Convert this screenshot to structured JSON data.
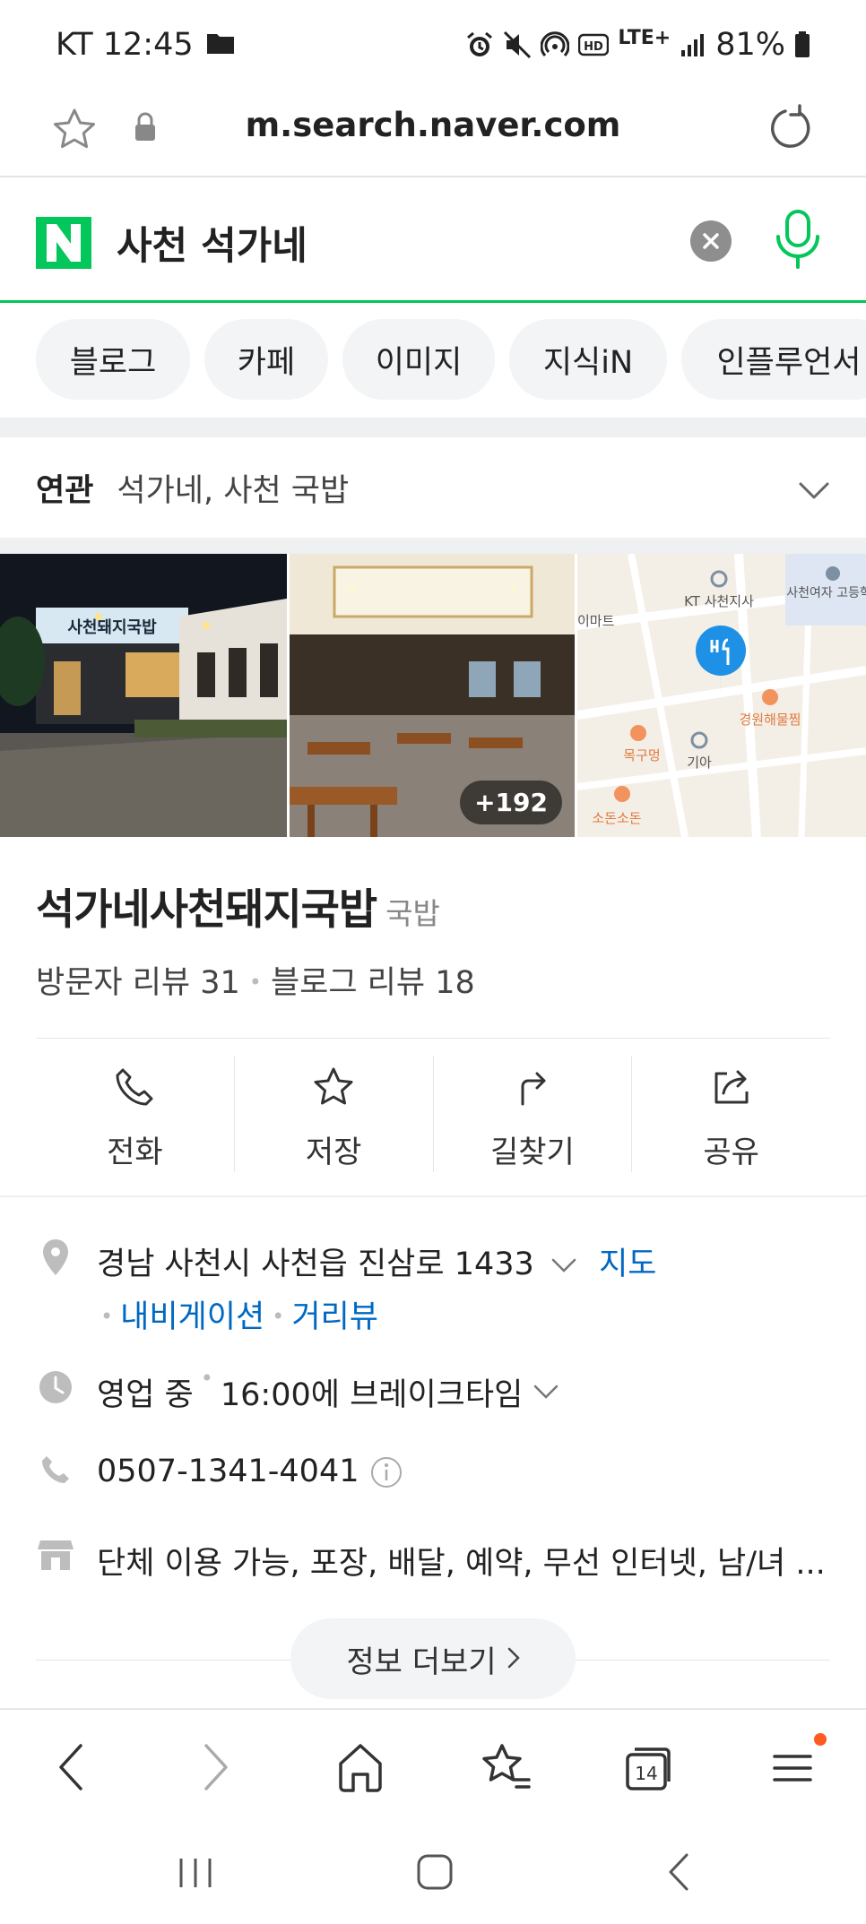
{
  "status_bar": {
    "carrier_time": "KT 12:45",
    "network": "LTE+",
    "battery": "81%"
  },
  "address_bar": {
    "url": "m.search.naver.com"
  },
  "search": {
    "logo": "N",
    "query": "사천 석가네"
  },
  "tabs": [
    {
      "label": "블로그"
    },
    {
      "label": "카페"
    },
    {
      "label": "이미지"
    },
    {
      "label": "지식iN"
    },
    {
      "label": "인플루언서"
    }
  ],
  "related": {
    "label": "연관",
    "items": "석가네, 사천 국밥"
  },
  "photos": {
    "sign_text": "사천돼지국밥",
    "count_badge": "+192",
    "map_labels": {
      "kt": "KT 사천지사",
      "school": "사천여자\n고등학교",
      "mart": "이마트",
      "restaurant1": "경원해물찜",
      "restaurant2": "목구멍",
      "kia": "기아",
      "restaurant3": "소돈소돈"
    }
  },
  "place": {
    "name": "석가네사천돼지국밥",
    "category": "국밥",
    "visitor_reviews": "방문자 리뷰 31",
    "blog_reviews": "블로그 리뷰 18"
  },
  "actions": [
    {
      "label": "전화",
      "icon": "phone-icon"
    },
    {
      "label": "저장",
      "icon": "star-icon"
    },
    {
      "label": "길찾기",
      "icon": "directions-icon"
    },
    {
      "label": "공유",
      "icon": "share-icon"
    }
  ],
  "info": {
    "address": "경남 사천시 사천읍 진삼로 1433",
    "map_link": "지도",
    "navigation_link": "내비게이션",
    "streetview_link": "거리뷰",
    "status": "영업 중",
    "break_time": "16:00에 브레이크타임",
    "phone": "0507-1341-4041",
    "amenities": "단체 이용 가능, 포장, 배달, 예약, 무선 인터넷, 남/녀 ..."
  },
  "more_button": "정보 더보기",
  "browser_nav": {
    "tab_count": "14"
  },
  "colors": {
    "naver_green": "#03c75a",
    "link_blue": "#0068c3",
    "map_pin": "#1e90e6"
  }
}
